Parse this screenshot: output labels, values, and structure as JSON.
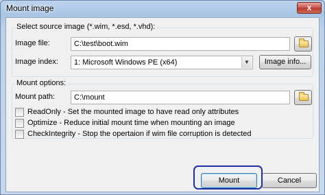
{
  "window": {
    "title": "Mount image",
    "close_glyph": "x"
  },
  "source_group": {
    "label": "Select source image (*.wim, *.esd, *.vhd):",
    "image_file_label": "Image file:",
    "image_file_value": "C:\\test\\boot.wim",
    "image_index_label": "Image index:",
    "image_index_selected": "1:  Microsoft Windows PE (x64)",
    "image_info_button": "Image info..."
  },
  "mount_group": {
    "label": "Mount options:",
    "mount_path_label": "Mount path:",
    "mount_path_value": "C:\\mount",
    "options": [
      {
        "label": "ReadOnly - Set the mounted image to have read only attributes",
        "checked": false
      },
      {
        "label": "Optimize - Reduce initial mount time when mounting an image",
        "checked": false
      },
      {
        "label": "CheckIntegrity - Stop the opertaion if wim file corruption is detected",
        "checked": false
      }
    ]
  },
  "buttons": {
    "mount": "Mount",
    "cancel": "Cancel"
  },
  "icons": {
    "folder": "folder-icon",
    "dropdown": "chevron-down-icon",
    "close": "close-icon"
  }
}
